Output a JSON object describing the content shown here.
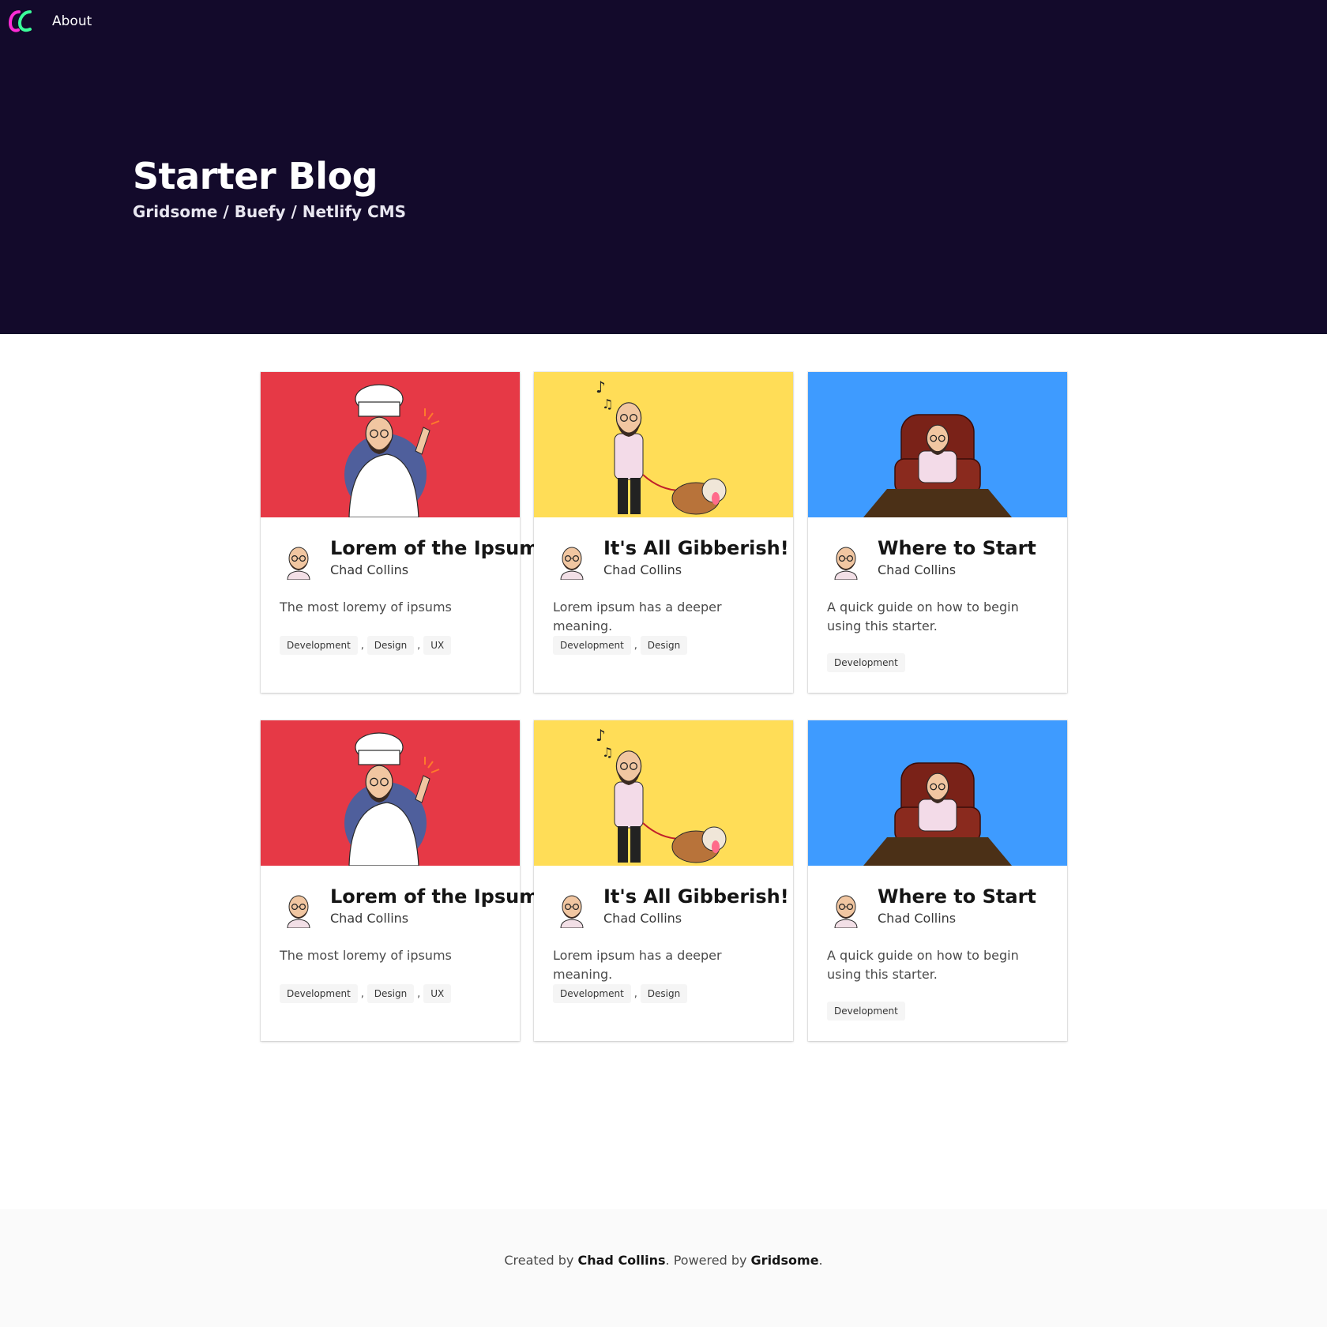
{
  "nav": {
    "about_label": "About",
    "logo_icon": "cc-logo-icon"
  },
  "hero": {
    "title": "Starter Blog",
    "subtitle": "Gridsome / Buefy / Netlify CMS"
  },
  "colors": {
    "hero_bg": "#130a2b",
    "red": "#e63946",
    "yellow": "#ffdd57",
    "blue": "#3e9bff",
    "logo_magenta": "#ff2bd6",
    "logo_green": "#3bff9a"
  },
  "posts": [
    {
      "title": "Lorem of the Ipsum",
      "author": "Chad Collins",
      "description": "The most loremy of ipsums",
      "tags": [
        "Development",
        "Design",
        "UX"
      ],
      "image": "chef-illustration",
      "image_color": "#e63946"
    },
    {
      "title": "It's All Gibberish!",
      "author": "Chad Collins",
      "description": "Lorem ipsum has a deeper meaning.",
      "tags": [
        "Development",
        "Design"
      ],
      "image": "dog-walk-illustration",
      "image_color": "#ffdd57"
    },
    {
      "title": "Where to Start",
      "author": "Chad Collins",
      "description": "A quick guide on how to begin using this starter.",
      "tags": [
        "Development"
      ],
      "image": "armchair-illustration",
      "image_color": "#3e9bff"
    },
    {
      "title": "Lorem of the Ipsum",
      "author": "Chad Collins",
      "description": "The most loremy of ipsums",
      "tags": [
        "Development",
        "Design",
        "UX"
      ],
      "image": "chef-illustration",
      "image_color": "#e63946"
    },
    {
      "title": "It's All Gibberish!",
      "author": "Chad Collins",
      "description": "Lorem ipsum has a deeper meaning.",
      "tags": [
        "Development",
        "Design"
      ],
      "image": "dog-walk-illustration",
      "image_color": "#ffdd57"
    },
    {
      "title": "Where to Start",
      "author": "Chad Collins",
      "description": "A quick guide on how to begin using this starter.",
      "tags": [
        "Development"
      ],
      "image": "armchair-illustration",
      "image_color": "#3e9bff"
    }
  ],
  "footer": {
    "prefix": "Created by ",
    "author": "Chad Collins",
    "middle": ". Powered by ",
    "powered_by": "Gridsome",
    "suffix": "."
  }
}
